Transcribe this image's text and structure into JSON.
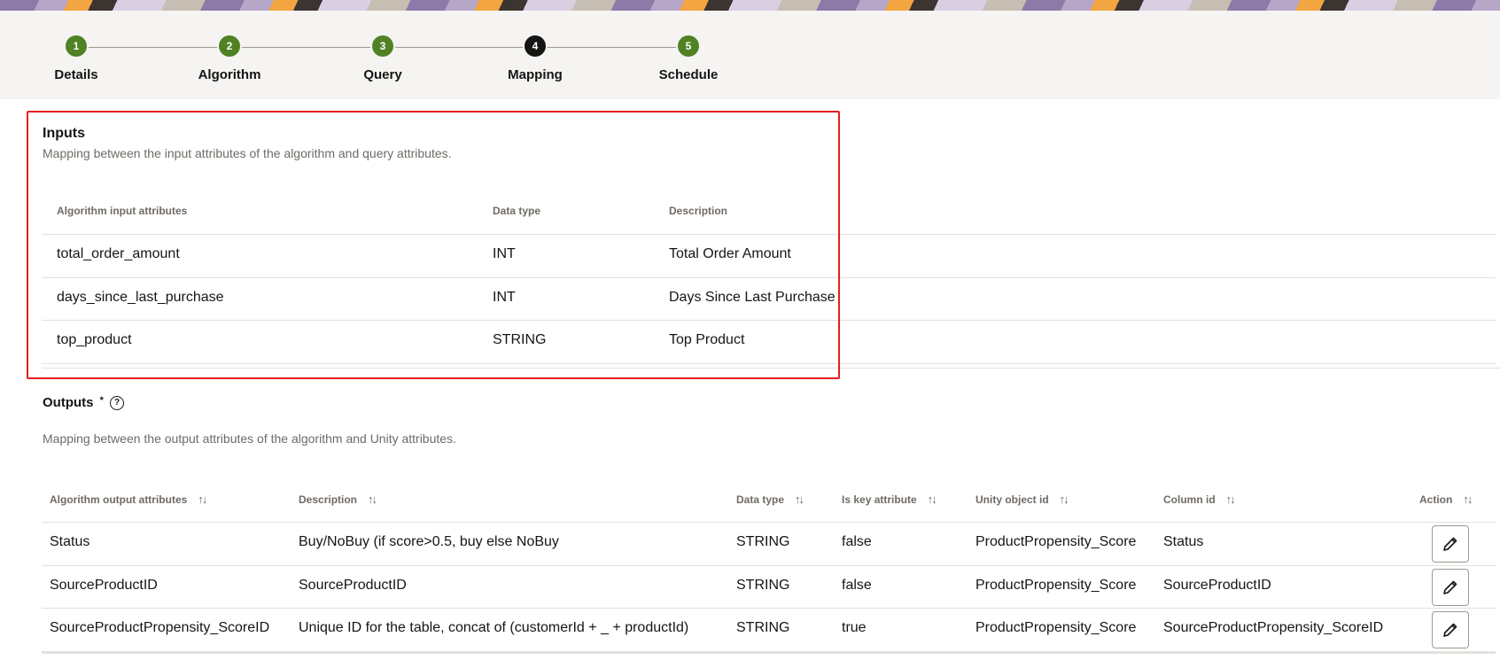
{
  "steps": [
    {
      "number": "1",
      "label": "Details"
    },
    {
      "number": "2",
      "label": "Algorithm"
    },
    {
      "number": "3",
      "label": "Query"
    },
    {
      "number": "4",
      "label": "Mapping"
    },
    {
      "number": "5",
      "label": "Schedule"
    }
  ],
  "inputs": {
    "title": "Inputs",
    "description": "Mapping between the input attributes of the algorithm and query attributes.",
    "columns": [
      "Algorithm input attributes",
      "Data type",
      "Description"
    ],
    "rows": [
      [
        "total_order_amount",
        "INT",
        "Total Order Amount"
      ],
      [
        "days_since_last_purchase",
        "INT",
        "Days Since Last Purchase"
      ],
      [
        "top_product",
        "STRING",
        "Top Product"
      ]
    ]
  },
  "outputs": {
    "title": "Outputs",
    "required_mark": "*",
    "help_icon": "?",
    "description": "Mapping between the output attributes of the algorithm and Unity attributes.",
    "columns": [
      "Algorithm output attributes",
      "Description",
      "Data type",
      "Is key attribute",
      "Unity object id",
      "Column id",
      "Action"
    ],
    "rows": [
      [
        "Status",
        "Buy/NoBuy (if score>0.5, buy else NoBuy",
        "STRING",
        "false",
        "ProductPropensity_Score",
        "Status"
      ],
      [
        "SourceProductID",
        "SourceProductID",
        "STRING",
        "false",
        "ProductPropensity_Score",
        "SourceProductID"
      ],
      [
        "SourceProductPropensity_ScoreID",
        "Unique ID for the table, concat of (customerId + _ + productId)",
        "STRING",
        "true",
        "ProductPropensity_Score",
        "SourceProductPropensity_ScoreID"
      ]
    ]
  },
  "colors": {
    "step_complete": "#508223",
    "step_current": "#161513",
    "highlight": "#e61e1e"
  }
}
